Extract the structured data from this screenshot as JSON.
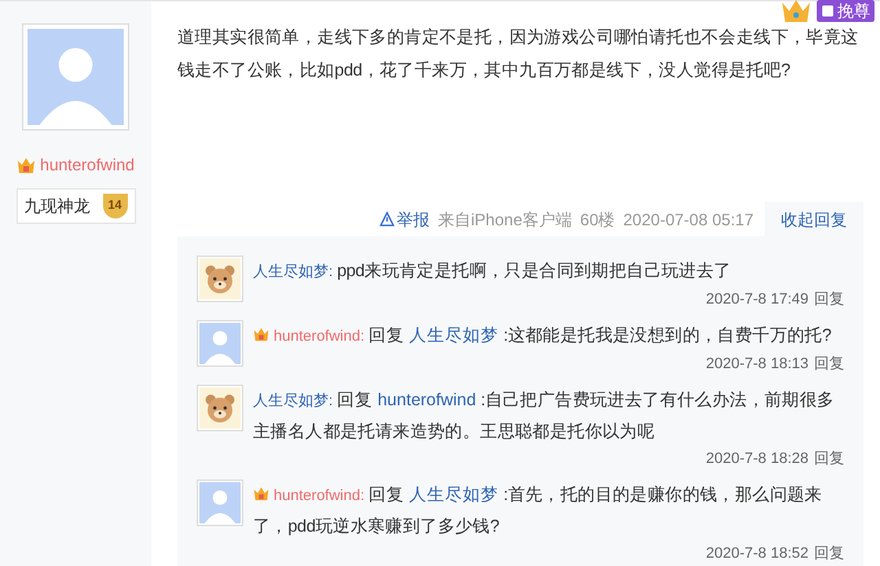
{
  "author": {
    "name": "hunterofwind",
    "vip": true,
    "level_title": "九现神龙",
    "level": "14"
  },
  "badge": {
    "label": "挽尊"
  },
  "post": {
    "text": "道理其实很简单，走线下多的肯定不是托，因为游戏公司哪怕请托也不会走线下，毕竟这钱走不了公账，比如pdd，花了千来万，其中九百万都是线下，没人觉得是托吧?",
    "report": "举报",
    "source": "来自iPhone客户端",
    "floor": "60楼",
    "time": "2020-07-08 05:17",
    "toggle": "收起回复"
  },
  "replies": [
    {
      "kind": "bear",
      "author": "人生尽如梦:",
      "vip": false,
      "text": "ppd来玩肯定是托啊，只是合同到期把自己玩进去了",
      "time": "2020-7-8 17:49",
      "action": "回复"
    },
    {
      "kind": "default",
      "author": "hunterofwind:",
      "vip": true,
      "reply_label": "回复",
      "reply_to": "人生尽如梦",
      "text": ":这都能是托我是没想到的，自费千万的托?",
      "time": "2020-7-8 18:13",
      "action": "回复"
    },
    {
      "kind": "bear",
      "author": "人生尽如梦:",
      "vip": false,
      "reply_label": "回复",
      "reply_to": "hunterofwind",
      "text": ":自己把广告费玩进去了有什么办法，前期很多主播名人都是托请来造势的。王思聪都是托你以为呢",
      "time": "2020-7-8 18:28",
      "action": "回复"
    },
    {
      "kind": "default",
      "author": "hunterofwind:",
      "vip": true,
      "reply_label": "回复",
      "reply_to": "人生尽如梦",
      "text": ":首先，托的目的是赚你的钱，那么问题来了，pdd玩逆水寒赚到了多少钱?",
      "time": "2020-7-8 18:52",
      "action": "回复"
    }
  ]
}
